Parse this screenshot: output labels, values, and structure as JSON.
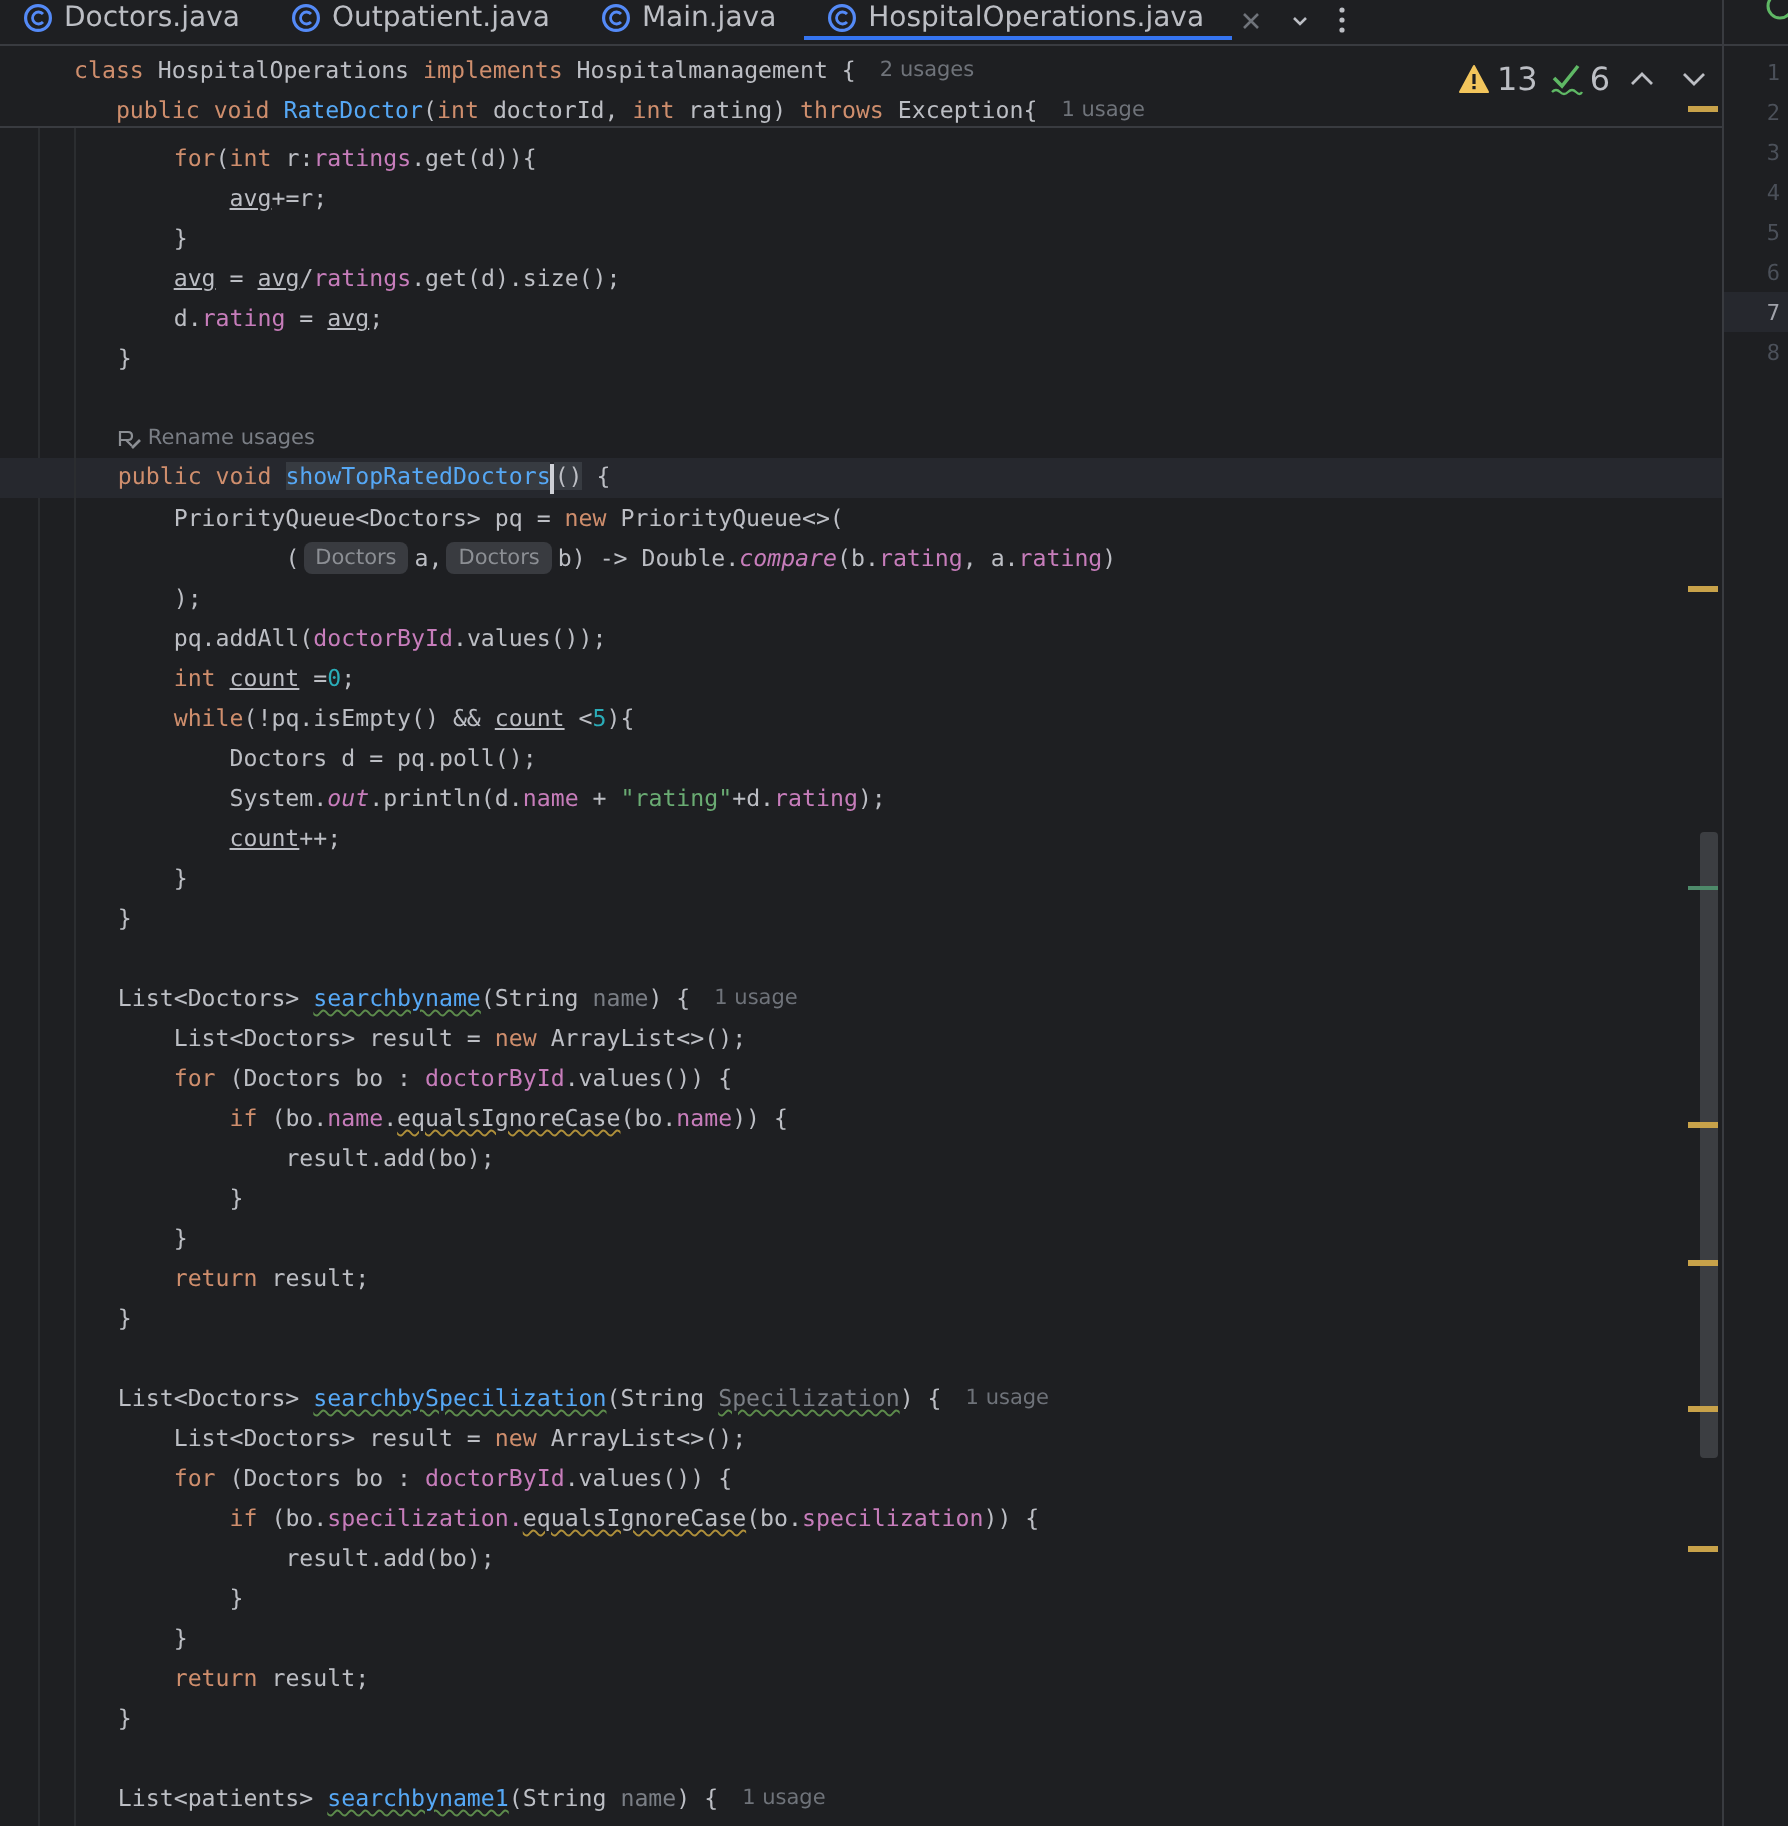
{
  "tabs": [
    {
      "label": "Doctors.java",
      "selected": false
    },
    {
      "label": "Outpatient.java",
      "selected": false
    },
    {
      "label": "Main.java",
      "selected": false
    },
    {
      "label": "HospitalOperations.java",
      "selected": true
    }
  ],
  "inspections": {
    "warnings": "13",
    "weak_warnings": "6"
  },
  "sticky_lines": [
    {
      "kind": "code",
      "tokens": [
        {
          "kind": "kw",
          "text": "class"
        },
        {
          "kind": "plain",
          "text": " HospitalOperations "
        },
        {
          "kind": "kw",
          "text": "implements"
        },
        {
          "kind": "plain",
          "text": " Hospitalmanagement {"
        },
        {
          "kind": "usages",
          "text": "2 usages"
        }
      ]
    },
    {
      "kind": "code",
      "tokens": [
        {
          "kind": "kw",
          "text": "   public void "
        },
        {
          "kind": "method",
          "text": "RateDoctor"
        },
        {
          "kind": "plain",
          "text": "("
        },
        {
          "kind": "kw",
          "text": "int"
        },
        {
          "kind": "plain",
          "text": " doctorId, "
        },
        {
          "kind": "kw",
          "text": "int"
        },
        {
          "kind": "plain",
          "text": " rating) "
        },
        {
          "kind": "kw",
          "text": "throws"
        },
        {
          "kind": "plain",
          "text": " Exception{"
        },
        {
          "kind": "usages",
          "text": "1 usage"
        }
      ]
    }
  ],
  "lines": [
    {
      "kind": "code",
      "current": false,
      "tokens": [
        {
          "kind": "kw",
          "text": "        for"
        },
        {
          "kind": "plain",
          "text": "("
        },
        {
          "kind": "kw",
          "text": "int"
        },
        {
          "kind": "plain",
          "text": " r:"
        },
        {
          "kind": "field",
          "text": "ratings"
        },
        {
          "kind": "plain",
          "text": ".get(d)){"
        }
      ]
    },
    {
      "kind": "code",
      "current": false,
      "tokens": [
        {
          "kind": "reassigned",
          "text": "            avg"
        },
        {
          "kind": "plain",
          "text": "+=r;"
        }
      ]
    },
    {
      "kind": "code",
      "current": false,
      "tokens": [
        {
          "kind": "plain",
          "text": "        }"
        }
      ]
    },
    {
      "kind": "code",
      "current": false,
      "tokens": [
        {
          "kind": "reassigned",
          "text": "        avg"
        },
        {
          "kind": "plain",
          "text": " = "
        },
        {
          "kind": "reassigned",
          "text": "avg"
        },
        {
          "kind": "plain",
          "text": "/"
        },
        {
          "kind": "field",
          "text": "ratings"
        },
        {
          "kind": "plain",
          "text": ".get(d).size();"
        }
      ]
    },
    {
      "kind": "code",
      "current": false,
      "tokens": [
        {
          "kind": "plain",
          "text": "        d."
        },
        {
          "kind": "field",
          "text": "rating"
        },
        {
          "kind": "plain",
          "text": " = "
        },
        {
          "kind": "reassigned",
          "text": "avg"
        },
        {
          "kind": "plain",
          "text": ";"
        }
      ]
    },
    {
      "kind": "code",
      "current": false,
      "tokens": [
        {
          "kind": "plain",
          "text": "    }"
        }
      ]
    },
    {
      "kind": "blank",
      "current": false
    },
    {
      "kind": "hint",
      "current": false,
      "text": "Rename usages"
    },
    {
      "kind": "code",
      "current": true,
      "tokens": [
        {
          "kind": "kw",
          "text": "    public void "
        },
        {
          "kind": "method_highlight",
          "text": "showTopRatedDoctors",
          "caret": true
        },
        {
          "kind": "plain_highlight",
          "text": "()"
        },
        {
          "kind": "plain",
          "text": " {"
        }
      ]
    },
    {
      "kind": "code",
      "current": false,
      "tokens": [
        {
          "kind": "plain",
          "text": "        PriorityQueue<Doctors> pq = "
        },
        {
          "kind": "kw",
          "text": "new"
        },
        {
          "kind": "plain",
          "text": " PriorityQueue<>("
        }
      ]
    },
    {
      "kind": "code",
      "current": false,
      "tokens": [
        {
          "kind": "plain",
          "text": "                ("
        },
        {
          "kind": "inlay",
          "text": "Doctors"
        },
        {
          "kind": "plain",
          "text": "a,"
        },
        {
          "kind": "inlay",
          "text": "Doctors"
        },
        {
          "kind": "plain",
          "text": "b) -> Double."
        },
        {
          "kind": "static",
          "text": "compare"
        },
        {
          "kind": "plain",
          "text": "(b."
        },
        {
          "kind": "field",
          "text": "rating"
        },
        {
          "kind": "plain",
          "text": ", a."
        },
        {
          "kind": "field",
          "text": "rating"
        },
        {
          "kind": "plain",
          "text": ")"
        }
      ]
    },
    {
      "kind": "code",
      "current": false,
      "tokens": [
        {
          "kind": "plain",
          "text": "        );"
        }
      ]
    },
    {
      "kind": "code",
      "current": false,
      "tokens": [
        {
          "kind": "plain",
          "text": "        pq.addAll("
        },
        {
          "kind": "field",
          "text": "doctorById"
        },
        {
          "kind": "plain",
          "text": ".values());"
        }
      ]
    },
    {
      "kind": "code",
      "current": false,
      "tokens": [
        {
          "kind": "kw",
          "text": "        int "
        },
        {
          "kind": "reassigned",
          "text": "count"
        },
        {
          "kind": "plain",
          "text": " ="
        },
        {
          "kind": "number",
          "text": "0"
        },
        {
          "kind": "plain",
          "text": ";"
        }
      ]
    },
    {
      "kind": "code",
      "current": false,
      "tokens": [
        {
          "kind": "kw",
          "text": "        while"
        },
        {
          "kind": "plain",
          "text": "(!pq.isEmpty() && "
        },
        {
          "kind": "reassigned",
          "text": "count"
        },
        {
          "kind": "plain",
          "text": " <"
        },
        {
          "kind": "number",
          "text": "5"
        },
        {
          "kind": "plain",
          "text": "){"
        }
      ]
    },
    {
      "kind": "code",
      "current": false,
      "tokens": [
        {
          "kind": "plain",
          "text": "            Doctors d = pq.poll();"
        }
      ]
    },
    {
      "kind": "code",
      "current": false,
      "tokens": [
        {
          "kind": "plain",
          "text": "            System."
        },
        {
          "kind": "static",
          "text": "out"
        },
        {
          "kind": "plain",
          "text": ".println(d."
        },
        {
          "kind": "field",
          "text": "name"
        },
        {
          "kind": "plain",
          "text": " + "
        },
        {
          "kind": "string",
          "text": "\"rating\""
        },
        {
          "kind": "plain",
          "text": "+d."
        },
        {
          "kind": "field",
          "text": "rating"
        },
        {
          "kind": "plain",
          "text": ");"
        }
      ]
    },
    {
      "kind": "code",
      "current": false,
      "tokens": [
        {
          "kind": "reassigned",
          "text": "            count"
        },
        {
          "kind": "plain",
          "text": "++;"
        }
      ]
    },
    {
      "kind": "code",
      "current": false,
      "tokens": [
        {
          "kind": "plain",
          "text": "        }"
        }
      ]
    },
    {
      "kind": "code",
      "current": false,
      "tokens": [
        {
          "kind": "plain",
          "text": "    }"
        }
      ]
    },
    {
      "kind": "blank",
      "current": false
    },
    {
      "kind": "code",
      "current": false,
      "tokens": [
        {
          "kind": "plain",
          "text": "    List<Doctors> "
        },
        {
          "kind": "method_typo",
          "text": "searchbyname"
        },
        {
          "kind": "plain",
          "text": "(String "
        },
        {
          "kind": "param",
          "text": "name"
        },
        {
          "kind": "plain",
          "text": ") {"
        },
        {
          "kind": "usages",
          "text": "1 usage"
        }
      ]
    },
    {
      "kind": "code",
      "current": false,
      "tokens": [
        {
          "kind": "plain",
          "text": "        List<Doctors> result = "
        },
        {
          "kind": "kw",
          "text": "new"
        },
        {
          "kind": "plain",
          "text": " ArrayList<>();"
        }
      ]
    },
    {
      "kind": "code",
      "current": false,
      "tokens": [
        {
          "kind": "kw",
          "text": "        for"
        },
        {
          "kind": "plain",
          "text": " (Doctors bo : "
        },
        {
          "kind": "field",
          "text": "doctorById"
        },
        {
          "kind": "plain",
          "text": ".values()) {"
        }
      ]
    },
    {
      "kind": "code",
      "current": false,
      "tokens": [
        {
          "kind": "kw",
          "text": "            if"
        },
        {
          "kind": "plain",
          "text": " (bo."
        },
        {
          "kind": "field",
          "text": "name"
        },
        {
          "kind": "plain",
          "text": "."
        },
        {
          "kind": "plain_warning",
          "text": "equalsIgnoreCase"
        },
        {
          "kind": "plain",
          "text": "(bo."
        },
        {
          "kind": "field",
          "text": "name"
        },
        {
          "kind": "plain",
          "text": ")) {"
        }
      ]
    },
    {
      "kind": "code",
      "current": false,
      "tokens": [
        {
          "kind": "plain",
          "text": "                result.add(bo);"
        }
      ]
    },
    {
      "kind": "code",
      "current": false,
      "tokens": [
        {
          "kind": "plain",
          "text": "            }"
        }
      ]
    },
    {
      "kind": "code",
      "current": false,
      "tokens": [
        {
          "kind": "plain",
          "text": "        }"
        }
      ]
    },
    {
      "kind": "code",
      "current": false,
      "tokens": [
        {
          "kind": "kw",
          "text": "        return"
        },
        {
          "kind": "plain",
          "text": " result;"
        }
      ]
    },
    {
      "kind": "code",
      "current": false,
      "tokens": [
        {
          "kind": "plain",
          "text": "    }"
        }
      ]
    },
    {
      "kind": "blank",
      "current": false
    },
    {
      "kind": "code",
      "current": false,
      "tokens": [
        {
          "kind": "plain",
          "text": "    List<Doctors> "
        },
        {
          "kind": "method_typo",
          "text": "searchbySpecilization"
        },
        {
          "kind": "plain",
          "text": "(String "
        },
        {
          "kind": "param_typo",
          "text": "Specilization"
        },
        {
          "kind": "plain",
          "text": ") {"
        },
        {
          "kind": "usages",
          "text": "1 usage"
        }
      ]
    },
    {
      "kind": "code",
      "current": false,
      "tokens": [
        {
          "kind": "plain",
          "text": "        List<Doctors> result = "
        },
        {
          "kind": "kw",
          "text": "new"
        },
        {
          "kind": "plain",
          "text": " ArrayList<>();"
        }
      ]
    },
    {
      "kind": "code",
      "current": false,
      "tokens": [
        {
          "kind": "kw",
          "text": "        for"
        },
        {
          "kind": "plain",
          "text": " (Doctors bo : "
        },
        {
          "kind": "field",
          "text": "doctorById"
        },
        {
          "kind": "plain",
          "text": ".values()) {"
        }
      ]
    },
    {
      "kind": "code",
      "current": false,
      "tokens": [
        {
          "kind": "kw",
          "text": "            if"
        },
        {
          "kind": "plain",
          "text": " (bo."
        },
        {
          "kind": "field",
          "text": "specilization."
        },
        {
          "kind": "plain_warning",
          "text": "equalsIgnoreCase"
        },
        {
          "kind": "plain",
          "text": "(bo."
        },
        {
          "kind": "field",
          "text": "specilization"
        },
        {
          "kind": "plain",
          "text": ")) {"
        }
      ]
    },
    {
      "kind": "code",
      "current": false,
      "tokens": [
        {
          "kind": "plain",
          "text": "                result.add(bo);"
        }
      ]
    },
    {
      "kind": "code",
      "current": false,
      "tokens": [
        {
          "kind": "plain",
          "text": "            }"
        }
      ]
    },
    {
      "kind": "code",
      "current": false,
      "tokens": [
        {
          "kind": "plain",
          "text": "        }"
        }
      ]
    },
    {
      "kind": "code",
      "current": false,
      "tokens": [
        {
          "kind": "kw",
          "text": "        return"
        },
        {
          "kind": "plain",
          "text": " result;"
        }
      ]
    },
    {
      "kind": "code",
      "current": false,
      "tokens": [
        {
          "kind": "plain",
          "text": "    }"
        }
      ]
    },
    {
      "kind": "blank",
      "current": false
    },
    {
      "kind": "code",
      "current": false,
      "tokens": [
        {
          "kind": "plain",
          "text": "    List<patients> "
        },
        {
          "kind": "method_typo",
          "text": "searchbyname1"
        },
        {
          "kind": "plain",
          "text": "(String "
        },
        {
          "kind": "param",
          "text": "name"
        },
        {
          "kind": "plain",
          "text": ") {"
        },
        {
          "kind": "usages",
          "text": "1 usage"
        }
      ]
    }
  ],
  "side_panel": {
    "line_numbers": [
      {
        "text": "1",
        "selected": false
      },
      {
        "text": "2",
        "selected": false
      },
      {
        "text": "3",
        "selected": false
      },
      {
        "text": "4",
        "selected": false
      },
      {
        "text": "5",
        "selected": false
      },
      {
        "text": "6",
        "selected": false
      },
      {
        "text": "7",
        "selected": true
      },
      {
        "text": "8",
        "selected": false
      }
    ]
  }
}
